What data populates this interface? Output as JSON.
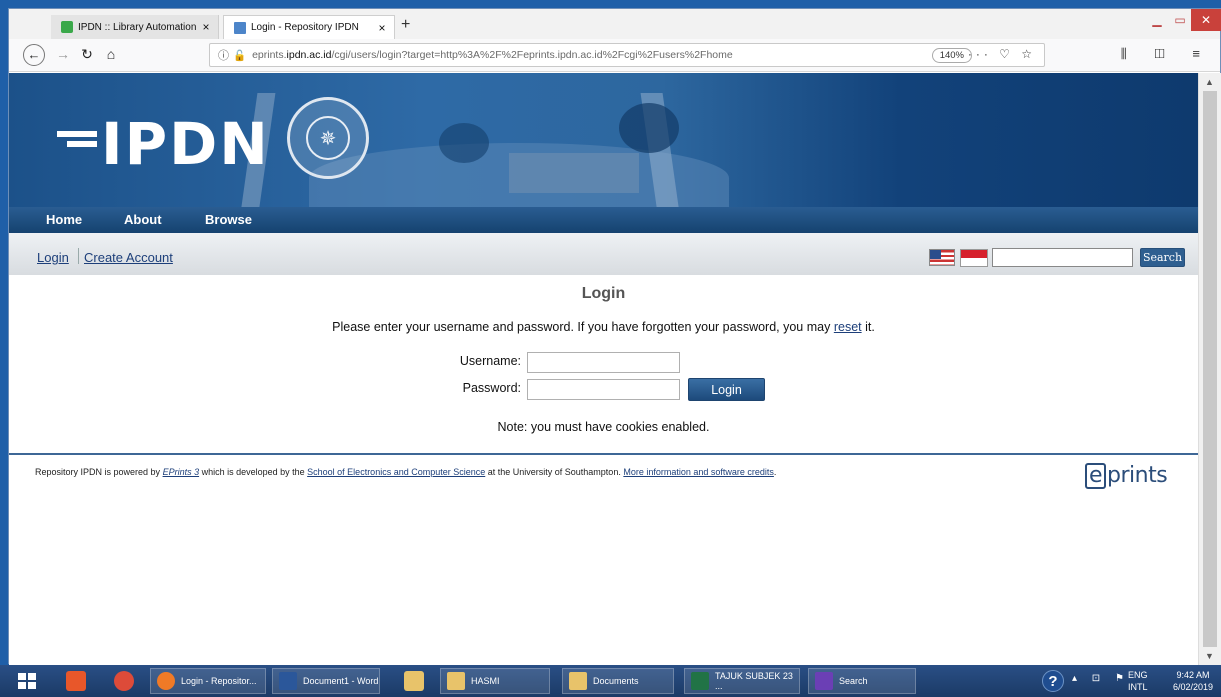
{
  "browser": {
    "tabs": [
      {
        "label": "IPDN :: Library Automation Sys"
      },
      {
        "label": "Login - Repository IPDN"
      }
    ],
    "tab_close": "×",
    "new_tab": "+",
    "url": {
      "prefix": "eprints.",
      "domain": "ipdn.ac.id",
      "path": "/cgi/users/login?target=http%3A%2F%2Feprints.ipdn.ac.id%2Fcgi%2Fusers%2Fhome"
    },
    "zoom": "140%",
    "page_actions": "··· ♡ ☆",
    "right_icons": "⫼ ◫ ≡"
  },
  "site": {
    "logo": "IPDN",
    "menu": {
      "home": "Home",
      "about": "About",
      "browse": "Browse"
    },
    "account": {
      "login": "Login",
      "create": "Create Account"
    },
    "search_button": "Search"
  },
  "login": {
    "title": "Login",
    "message_pre": "Please enter your username and password. If you have forgotten your password, you may ",
    "message_link": "reset",
    "message_post": " it.",
    "username_label": "Username:",
    "password_label": "Password:",
    "button": "Login",
    "note": "Note: you must have cookies enabled."
  },
  "footer": {
    "t1": "Repository IPDN is powered by ",
    "l1": "EPrints 3",
    "t2": " which is developed by the ",
    "l2": "School of Electronics and Computer Science",
    "t3": " at the University of Southampton. ",
    "l3": "More information and software credits",
    "t4": ".",
    "logo_e": "e",
    "logo_rest": "prints"
  },
  "taskbar": {
    "items": [
      {
        "label": "Login - Repositor..."
      },
      {
        "label": "Document1 - Word"
      },
      {
        "label": "HASMI"
      },
      {
        "label": "Documents"
      },
      {
        "label": "TAJUK SUBJEK 23 ..."
      },
      {
        "label": "Search"
      }
    ],
    "lang1": "ENG",
    "lang2": "INTL",
    "time": "9:42 AM",
    "date": "6/02/2019"
  },
  "colors": {
    "banner": "#1c5189",
    "link": "#1d3f7a",
    "button": "#2f5f90"
  }
}
